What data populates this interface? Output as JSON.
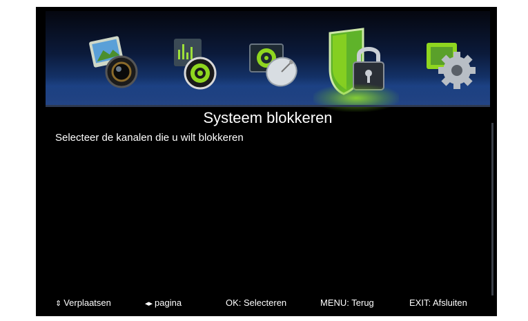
{
  "menu": {
    "items": [
      {
        "icon": "photo-media-icon",
        "active": false
      },
      {
        "icon": "audio-speaker-icon",
        "active": false
      },
      {
        "icon": "satellite-dish-icon",
        "active": false
      },
      {
        "icon": "shield-lock-icon",
        "active": true
      },
      {
        "icon": "settings-gear-icon",
        "active": false
      }
    ],
    "accent_color": "#8fd61f"
  },
  "screen": {
    "title": "Systeem blokkeren",
    "subtitle": "Selecteer de kanalen die u wilt blokkeren"
  },
  "footer": {
    "move_glyph": "⇕",
    "move_label": "Verplaatsen",
    "page_glyph": "◂▸",
    "page_label": "pagina",
    "ok_label": "OK: Selecteren",
    "menu_label": "MENU: Terug",
    "exit_label": "EXIT: Afsluiten"
  }
}
